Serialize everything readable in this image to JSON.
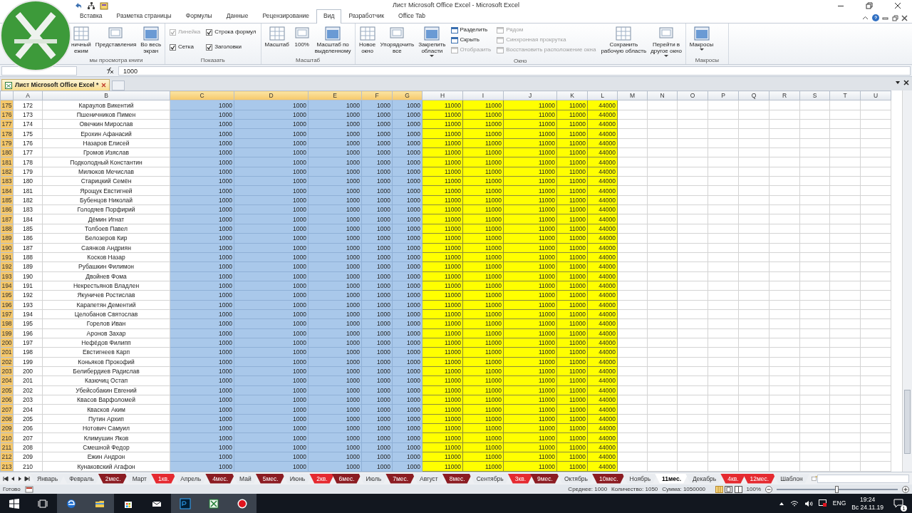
{
  "window": {
    "title": "Лист Microsoft Office Excel - Microsoft Excel"
  },
  "ribbon_tabs": [
    {
      "label": "Вставка",
      "selected": false
    },
    {
      "label": "Разметка страницы",
      "selected": false
    },
    {
      "label": "Формулы",
      "selected": false
    },
    {
      "label": "Данные",
      "selected": false
    },
    {
      "label": "Рецензирование",
      "selected": false
    },
    {
      "label": "Вид",
      "selected": true
    },
    {
      "label": "Разработчик",
      "selected": false
    },
    {
      "label": "Office Tab",
      "selected": false
    }
  ],
  "ribbon_groups": [
    {
      "label": "мы просмотра книги",
      "items": [
        {
          "kind": "large",
          "label": "ничный\nежим"
        },
        {
          "kind": "large",
          "label": "Представления"
        },
        {
          "kind": "large",
          "label": "Во весь\nэкран"
        }
      ]
    },
    {
      "label": "Показать",
      "items": [
        {
          "kind": "stack",
          "items": [
            {
              "kind": "check",
              "label": "Линейка",
              "checked": true,
              "disabled": true
            },
            {
              "kind": "check",
              "label": "Сетка",
              "checked": true,
              "disabled": false
            }
          ]
        },
        {
          "kind": "stack",
          "items": [
            {
              "kind": "check",
              "label": "Строка формул",
              "checked": true,
              "disabled": false
            },
            {
              "kind": "check",
              "label": "Заголовки",
              "checked": true,
              "disabled": false
            }
          ]
        }
      ]
    },
    {
      "label": "Масштаб",
      "items": [
        {
          "kind": "large",
          "label": "Масштаб"
        },
        {
          "kind": "large",
          "label": "100%"
        },
        {
          "kind": "large",
          "label": "Масштаб по\nвыделенному"
        }
      ]
    },
    {
      "label": "Окно",
      "items": [
        {
          "kind": "large",
          "label": "Новое\nокно"
        },
        {
          "kind": "large",
          "label": "Упорядочить\nвсе"
        },
        {
          "kind": "large",
          "label": "Закрепить\nобласти",
          "dropdown": true
        },
        {
          "kind": "stack",
          "items": [
            {
              "kind": "small",
              "label": "Разделить",
              "disabled": false
            },
            {
              "kind": "small",
              "label": "Скрыть",
              "disabled": false
            },
            {
              "kind": "small",
              "label": "Отобразить",
              "disabled": true
            }
          ]
        },
        {
          "kind": "stack",
          "items": [
            {
              "kind": "small",
              "label": "Рядом",
              "disabled": true
            },
            {
              "kind": "small",
              "label": "Синхронная прокрутка",
              "disabled": true
            },
            {
              "kind": "small",
              "label": "Восстановить расположение окна",
              "disabled": true
            }
          ]
        },
        {
          "kind": "large",
          "label": "Сохранить\nрабочую область"
        },
        {
          "kind": "large",
          "label": "Перейти в\nдругое окно",
          "dropdown": true
        }
      ]
    },
    {
      "label": "Макросы",
      "items": [
        {
          "kind": "large",
          "label": "Макросы",
          "dropdown": true
        }
      ]
    }
  ],
  "formula_bar": {
    "value": "1000"
  },
  "workbook_tabs": [
    {
      "label": "Лист Microsoft Office Excel *",
      "selected": true
    }
  ],
  "sheet": {
    "columns": [
      {
        "label": "A",
        "selected": false
      },
      {
        "label": "B",
        "selected": false
      },
      {
        "label": "C",
        "selected": true
      },
      {
        "label": "D",
        "selected": true
      },
      {
        "label": "E",
        "selected": true
      },
      {
        "label": "F",
        "selected": true
      },
      {
        "label": "G",
        "selected": true
      },
      {
        "label": "H",
        "selected": false,
        "color": "#ffff00"
      },
      {
        "label": "I",
        "selected": false,
        "color": "#ffff00"
      },
      {
        "label": "J",
        "selected": false,
        "color": "#ffff00"
      },
      {
        "label": "K",
        "selected": false,
        "color": "#ffff00"
      },
      {
        "label": "L",
        "selected": false,
        "color": "#ffff00"
      },
      {
        "label": "M",
        "selected": false
      },
      {
        "label": "N",
        "selected": false
      },
      {
        "label": "O",
        "selected": false
      },
      {
        "label": "P",
        "selected": false
      },
      {
        "label": "Q",
        "selected": false
      },
      {
        "label": "R",
        "selected": false
      },
      {
        "label": "S",
        "selected": false
      },
      {
        "label": "T",
        "selected": false
      },
      {
        "label": "U",
        "selected": false
      }
    ],
    "rows": [
      {
        "number": "175",
        "selected": true,
        "cells": [
          "172",
          "Караулов Викентий",
          "1000",
          "1000",
          "1000",
          "1000",
          "1000",
          "11000",
          "11000",
          "11000",
          "11000",
          "44000"
        ]
      },
      {
        "number": "176",
        "selected": true,
        "cells": [
          "173",
          "Пшеничников Пимен",
          "1000",
          "1000",
          "1000",
          "1000",
          "1000",
          "11000",
          "11000",
          "11000",
          "11000",
          "44000"
        ]
      },
      {
        "number": "177",
        "selected": true,
        "cells": [
          "174",
          "Овечкин Мирослав",
          "1000",
          "1000",
          "1000",
          "1000",
          "1000",
          "11000",
          "11000",
          "11000",
          "11000",
          "44000"
        ]
      },
      {
        "number": "178",
        "selected": true,
        "cells": [
          "175",
          "Ерохин Афанасий",
          "1000",
          "1000",
          "1000",
          "1000",
          "1000",
          "11000",
          "11000",
          "11000",
          "11000",
          "44000"
        ]
      },
      {
        "number": "179",
        "selected": true,
        "cells": [
          "176",
          "Назаров Елисей",
          "1000",
          "1000",
          "1000",
          "1000",
          "1000",
          "11000",
          "11000",
          "11000",
          "11000",
          "44000"
        ]
      },
      {
        "number": "180",
        "selected": true,
        "cells": [
          "177",
          "Громов Изяслав",
          "1000",
          "1000",
          "1000",
          "1000",
          "1000",
          "11000",
          "11000",
          "11000",
          "11000",
          "44000"
        ]
      },
      {
        "number": "181",
        "selected": true,
        "cells": [
          "178",
          "Подколодный Константин",
          "1000",
          "1000",
          "1000",
          "1000",
          "1000",
          "11000",
          "11000",
          "11000",
          "11000",
          "44000"
        ]
      },
      {
        "number": "182",
        "selected": true,
        "cells": [
          "179",
          "Милюков Мечислав",
          "1000",
          "1000",
          "1000",
          "1000",
          "1000",
          "11000",
          "11000",
          "11000",
          "11000",
          "44000"
        ]
      },
      {
        "number": "183",
        "selected": true,
        "cells": [
          "180",
          "Старицкий Семён",
          "1000",
          "1000",
          "1000",
          "1000",
          "1000",
          "11000",
          "11000",
          "11000",
          "11000",
          "44000"
        ]
      },
      {
        "number": "184",
        "selected": true,
        "cells": [
          "181",
          "Ярощук Евстигней",
          "1000",
          "1000",
          "1000",
          "1000",
          "1000",
          "11000",
          "11000",
          "11000",
          "11000",
          "44000"
        ]
      },
      {
        "number": "185",
        "selected": true,
        "cells": [
          "182",
          "Бубенцов Николай",
          "1000",
          "1000",
          "1000",
          "1000",
          "1000",
          "11000",
          "11000",
          "11000",
          "11000",
          "44000"
        ]
      },
      {
        "number": "186",
        "selected": true,
        "cells": [
          "183",
          "Голодяев Порфирий",
          "1000",
          "1000",
          "1000",
          "1000",
          "1000",
          "11000",
          "11000",
          "11000",
          "11000",
          "44000"
        ]
      },
      {
        "number": "187",
        "selected": true,
        "cells": [
          "184",
          "Дёмин Игнат",
          "1000",
          "1000",
          "1000",
          "1000",
          "1000",
          "11000",
          "11000",
          "11000",
          "11000",
          "44000"
        ]
      },
      {
        "number": "188",
        "selected": true,
        "cells": [
          "185",
          "Толбоев Павел",
          "1000",
          "1000",
          "1000",
          "1000",
          "1000",
          "11000",
          "11000",
          "11000",
          "11000",
          "44000"
        ]
      },
      {
        "number": "189",
        "selected": true,
        "cells": [
          "186",
          "Белозеров Кир",
          "1000",
          "1000",
          "1000",
          "1000",
          "1000",
          "11000",
          "11000",
          "11000",
          "11000",
          "44000"
        ]
      },
      {
        "number": "190",
        "selected": true,
        "cells": [
          "187",
          "Саянков Андриян",
          "1000",
          "1000",
          "1000",
          "1000",
          "1000",
          "11000",
          "11000",
          "11000",
          "11000",
          "44000"
        ]
      },
      {
        "number": "191",
        "selected": true,
        "cells": [
          "188",
          "Косков Назар",
          "1000",
          "1000",
          "1000",
          "1000",
          "1000",
          "11000",
          "11000",
          "11000",
          "11000",
          "44000"
        ]
      },
      {
        "number": "192",
        "selected": true,
        "cells": [
          "189",
          "Рубашкин Филимон",
          "1000",
          "1000",
          "1000",
          "1000",
          "1000",
          "11000",
          "11000",
          "11000",
          "11000",
          "44000"
        ]
      },
      {
        "number": "193",
        "selected": true,
        "cells": [
          "190",
          "Двойнев Фома",
          "1000",
          "1000",
          "1000",
          "1000",
          "1000",
          "11000",
          "11000",
          "11000",
          "11000",
          "44000"
        ]
      },
      {
        "number": "194",
        "selected": true,
        "cells": [
          "191",
          "Некрестьянов Владлен",
          "1000",
          "1000",
          "1000",
          "1000",
          "1000",
          "11000",
          "11000",
          "11000",
          "11000",
          "44000"
        ]
      },
      {
        "number": "195",
        "selected": true,
        "cells": [
          "192",
          "Якуничев Ростислав",
          "1000",
          "1000",
          "1000",
          "1000",
          "1000",
          "11000",
          "11000",
          "11000",
          "11000",
          "44000"
        ]
      },
      {
        "number": "196",
        "selected": true,
        "cells": [
          "193",
          "Карапетян Дементий",
          "1000",
          "1000",
          "1000",
          "1000",
          "1000",
          "11000",
          "11000",
          "11000",
          "11000",
          "44000"
        ]
      },
      {
        "number": "197",
        "selected": true,
        "cells": [
          "194",
          "Целобанов Святослав",
          "1000",
          "1000",
          "1000",
          "1000",
          "1000",
          "11000",
          "11000",
          "11000",
          "11000",
          "44000"
        ]
      },
      {
        "number": "198",
        "selected": true,
        "cells": [
          "195",
          "Горелов Иван",
          "1000",
          "1000",
          "1000",
          "1000",
          "1000",
          "11000",
          "11000",
          "11000",
          "11000",
          "44000"
        ]
      },
      {
        "number": "199",
        "selected": true,
        "cells": [
          "196",
          "Аронов Захар",
          "1000",
          "1000",
          "1000",
          "1000",
          "1000",
          "11000",
          "11000",
          "11000",
          "11000",
          "44000"
        ]
      },
      {
        "number": "200",
        "selected": true,
        "cells": [
          "197",
          "Нефёдов Филипп",
          "1000",
          "1000",
          "1000",
          "1000",
          "1000",
          "11000",
          "11000",
          "11000",
          "11000",
          "44000"
        ]
      },
      {
        "number": "201",
        "selected": true,
        "cells": [
          "198",
          "Евстигнеев Карп",
          "1000",
          "1000",
          "1000",
          "1000",
          "1000",
          "11000",
          "11000",
          "11000",
          "11000",
          "44000"
        ]
      },
      {
        "number": "202",
        "selected": true,
        "cells": [
          "199",
          "Коньяков Прокофий",
          "1000",
          "1000",
          "1000",
          "1000",
          "1000",
          "11000",
          "11000",
          "11000",
          "11000",
          "44000"
        ]
      },
      {
        "number": "203",
        "selected": true,
        "cells": [
          "200",
          "Белибердиев Радислав",
          "1000",
          "1000",
          "1000",
          "1000",
          "1000",
          "11000",
          "11000",
          "11000",
          "11000",
          "44000"
        ]
      },
      {
        "number": "204",
        "selected": true,
        "cells": [
          "201",
          "Казючиц Остап",
          "1000",
          "1000",
          "1000",
          "1000",
          "1000",
          "11000",
          "11000",
          "11000",
          "11000",
          "44000"
        ]
      },
      {
        "number": "205",
        "selected": true,
        "cells": [
          "202",
          "Убейсобакин Евгений",
          "1000",
          "1000",
          "1000",
          "1000",
          "1000",
          "11000",
          "11000",
          "11000",
          "11000",
          "44000"
        ]
      },
      {
        "number": "206",
        "selected": true,
        "cells": [
          "203",
          "Квасов Варфоломей",
          "1000",
          "1000",
          "1000",
          "1000",
          "1000",
          "11000",
          "11000",
          "11000",
          "11000",
          "44000"
        ]
      },
      {
        "number": "207",
        "selected": true,
        "cells": [
          "204",
          "Квасков Аким",
          "1000",
          "1000",
          "1000",
          "1000",
          "1000",
          "11000",
          "11000",
          "11000",
          "11000",
          "44000"
        ]
      },
      {
        "number": "208",
        "selected": true,
        "cells": [
          "205",
          "Путин Архип",
          "1000",
          "1000",
          "1000",
          "1000",
          "1000",
          "11000",
          "11000",
          "11000",
          "11000",
          "44000"
        ]
      },
      {
        "number": "209",
        "selected": true,
        "cells": [
          "206",
          "Нотович Самуил",
          "1000",
          "1000",
          "1000",
          "1000",
          "1000",
          "11000",
          "11000",
          "11000",
          "11000",
          "44000"
        ]
      },
      {
        "number": "210",
        "selected": true,
        "cells": [
          "207",
          "Климушин Яков",
          "1000",
          "1000",
          "1000",
          "1000",
          "1000",
          "11000",
          "11000",
          "11000",
          "11000",
          "44000"
        ]
      },
      {
        "number": "211",
        "selected": true,
        "cells": [
          "208",
          "Смешной Федор",
          "1000",
          "1000",
          "1000",
          "1000",
          "1000",
          "11000",
          "11000",
          "11000",
          "11000",
          "44000"
        ]
      },
      {
        "number": "212",
        "selected": true,
        "cells": [
          "209",
          "Ежин Андрон",
          "1000",
          "1000",
          "1000",
          "1000",
          "1000",
          "11000",
          "11000",
          "11000",
          "11000",
          "44000"
        ]
      },
      {
        "number": "213",
        "selected": true,
        "cells": [
          "210",
          "Кунаковский Агафон",
          "1000",
          "1000",
          "1000",
          "1000",
          "1000",
          "11000",
          "11000",
          "11000",
          "11000",
          "44000"
        ]
      }
    ]
  },
  "sheet_tabs": [
    {
      "label": "Январь",
      "selected": false
    },
    {
      "label": "Февраль",
      "selected": false
    },
    {
      "label": "2мес.",
      "selected": false,
      "color": "#8b1c22"
    },
    {
      "label": "Март",
      "selected": false
    },
    {
      "label": "1кв.",
      "selected": false,
      "color": "#e52a30"
    },
    {
      "label": "Апрель",
      "selected": false
    },
    {
      "label": "4мес.",
      "selected": false,
      "color": "#8b1c22"
    },
    {
      "label": "Май",
      "selected": false
    },
    {
      "label": "5мес.",
      "selected": false,
      "color": "#8b1c22"
    },
    {
      "label": "Июнь",
      "selected": false
    },
    {
      "label": "2кв.",
      "selected": false,
      "color": "#e52a30"
    },
    {
      "label": "6мес.",
      "selected": false,
      "color": "#8b1c22"
    },
    {
      "label": "Июль",
      "selected": false
    },
    {
      "label": "7мес.",
      "selected": false,
      "color": "#8b1c22"
    },
    {
      "label": "Август",
      "selected": false
    },
    {
      "label": "8мес.",
      "selected": false,
      "color": "#8b1c22"
    },
    {
      "label": "Сентябрь",
      "selected": false
    },
    {
      "label": "3кв.",
      "selected": false,
      "color": "#e52a30"
    },
    {
      "label": "9мес.",
      "selected": false,
      "color": "#8b1c22"
    },
    {
      "label": "Октябрь",
      "selected": false
    },
    {
      "label": "10мес.",
      "selected": false,
      "color": "#8b1c22"
    },
    {
      "label": "Ноябрь",
      "selected": false
    },
    {
      "label": "11мес.",
      "selected": true
    },
    {
      "label": "Декабрь",
      "selected": false
    },
    {
      "label": "4кв.",
      "selected": false,
      "color": "#e52a30"
    },
    {
      "label": "12мес.",
      "selected": false,
      "color": "#e52a30"
    },
    {
      "label": "Шаблон",
      "selected": false
    }
  ],
  "status_bar": {
    "state": "Готово",
    "average": "Среднее: 1000",
    "count": "Количество: 1050",
    "sum": "Сумма: 1050000",
    "zoom": "100%",
    "level": 0.5
  },
  "taskbar": {
    "language": "ENG",
    "time": "19:24",
    "date": "Вс 24.11.19",
    "notifications": "1"
  }
}
